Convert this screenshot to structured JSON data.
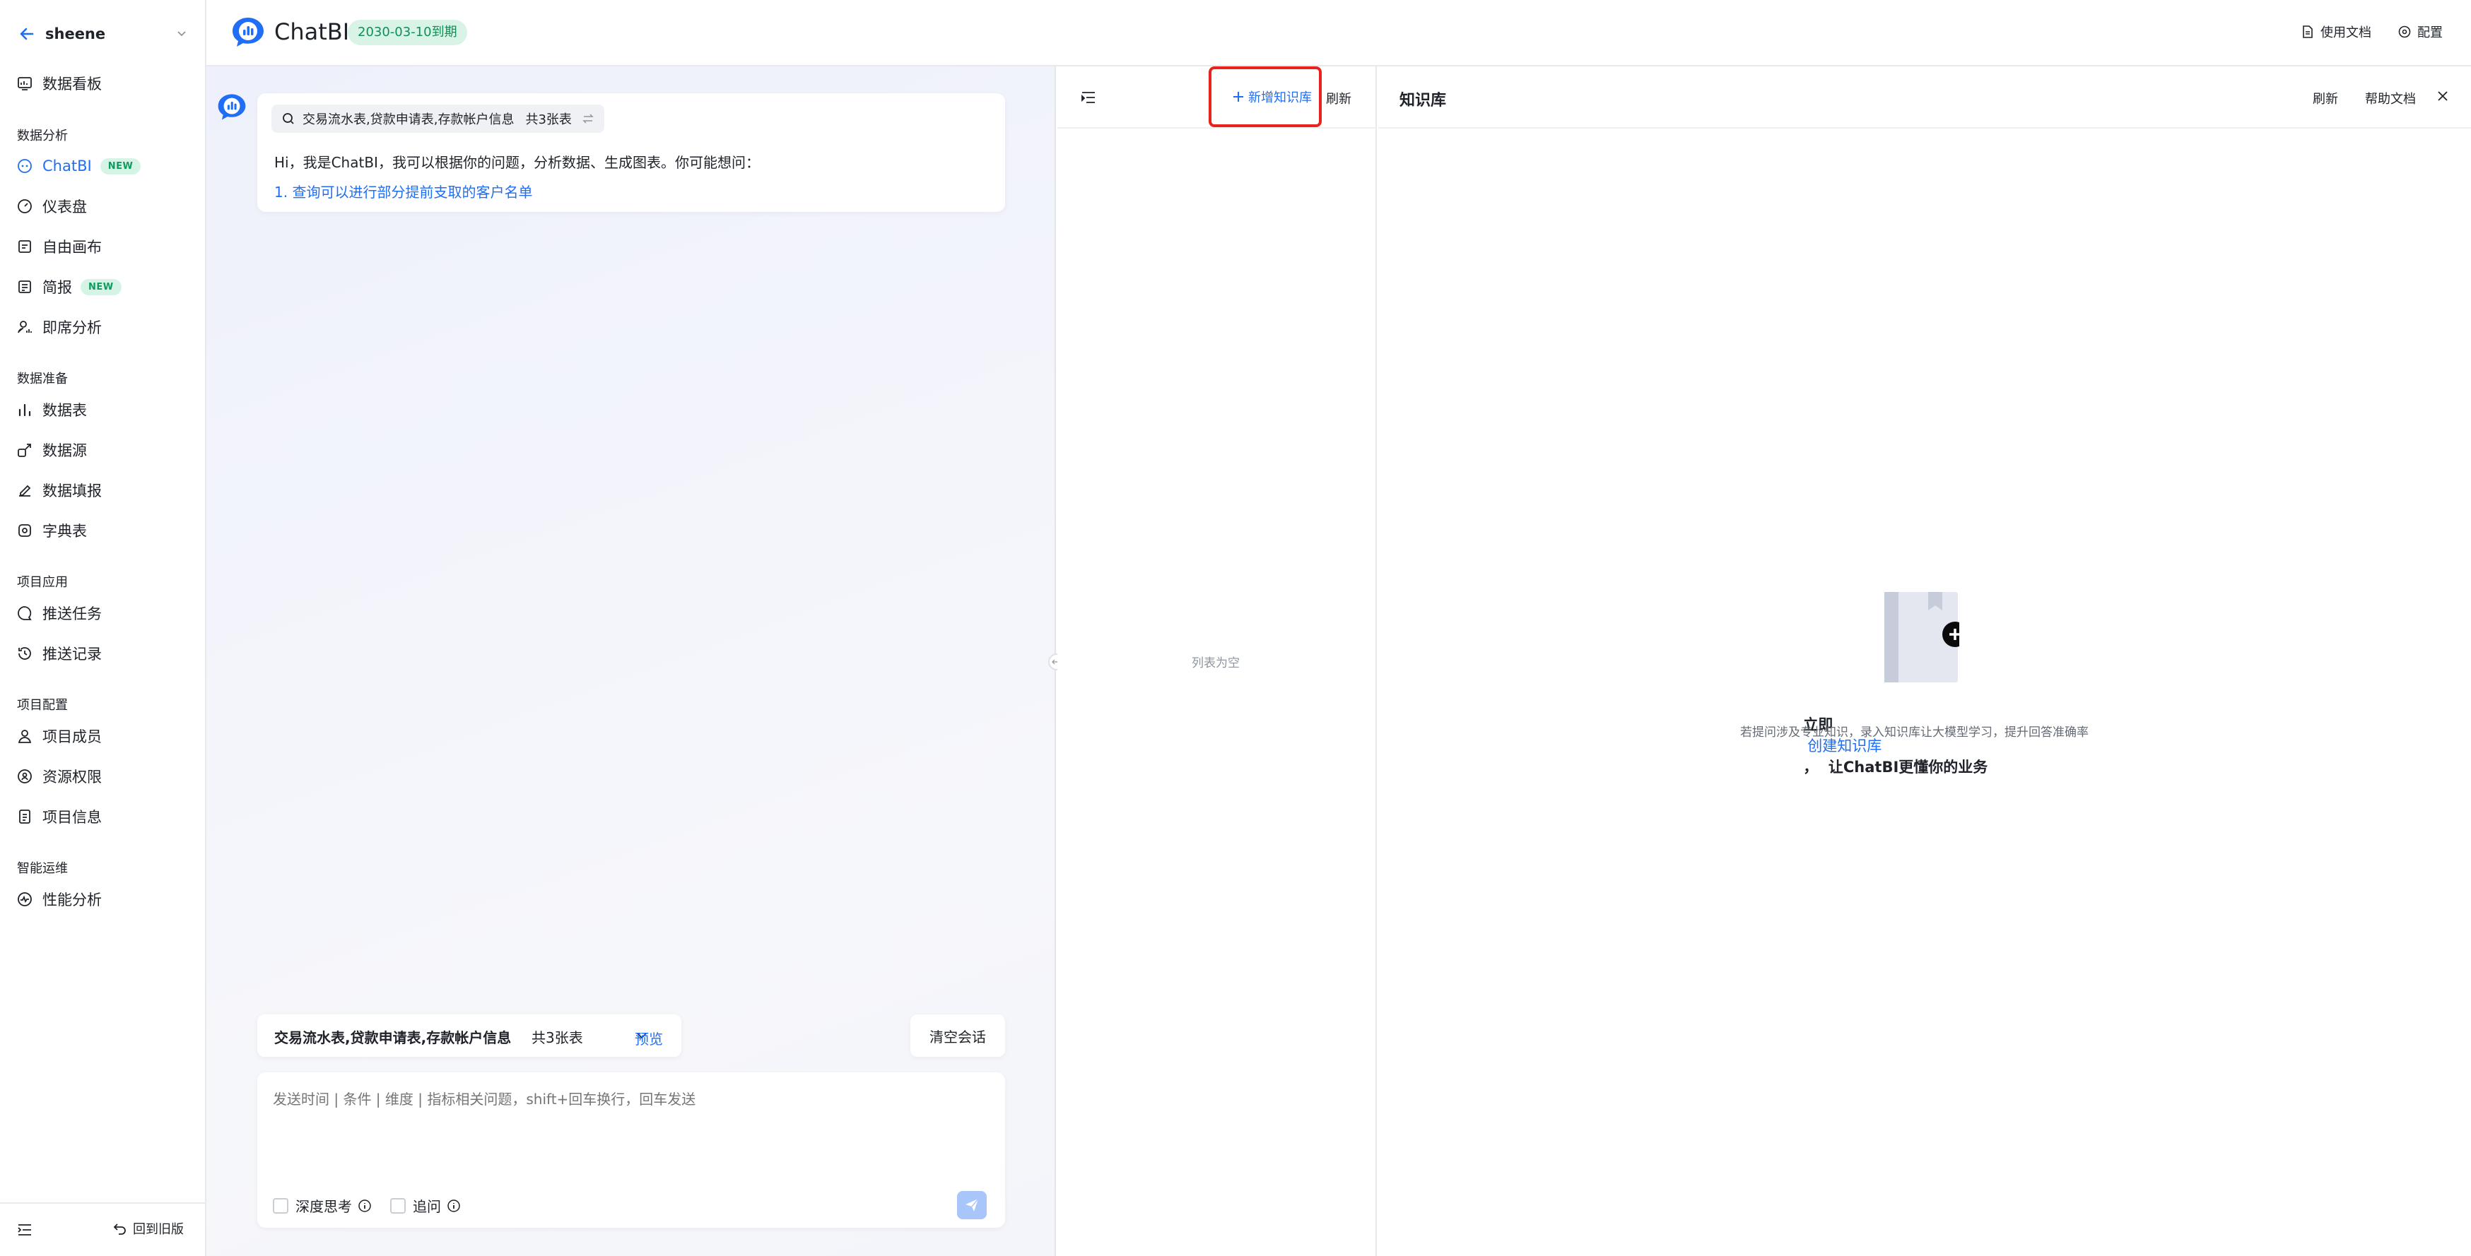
{
  "sidebar": {
    "project": "sheene",
    "top_item": "数据看板",
    "sections": [
      {
        "title": "数据分析",
        "items": [
          {
            "label": "ChatBI",
            "badge": "NEW",
            "active": true
          },
          {
            "label": "仪表盘"
          },
          {
            "label": "自由画布"
          },
          {
            "label": "简报",
            "badge": "NEW"
          },
          {
            "label": "即席分析"
          }
        ]
      },
      {
        "title": "数据准备",
        "items": [
          {
            "label": "数据表"
          },
          {
            "label": "数据源"
          },
          {
            "label": "数据填报"
          },
          {
            "label": "字典表"
          }
        ]
      },
      {
        "title": "项目应用",
        "items": [
          {
            "label": "推送任务"
          },
          {
            "label": "推送记录"
          }
        ]
      },
      {
        "title": "项目配置",
        "items": [
          {
            "label": "项目成员"
          },
          {
            "label": "资源权限"
          },
          {
            "label": "项目信息"
          }
        ]
      },
      {
        "title": "智能运维",
        "items": [
          {
            "label": "性能分析"
          }
        ]
      }
    ],
    "footer": {
      "back_label": "回到旧版"
    }
  },
  "topbar": {
    "title": "ChatBI",
    "expiry": "2030-03-10到期",
    "docs": "使用文档",
    "config": "配置"
  },
  "chat": {
    "tables_chip": "交易流水表,贷款申请表,存款帐户信息",
    "tables_count": "共3张表",
    "greeting": "Hi，我是ChatBI，我可以根据你的问题，分析数据、生成图表。你可能想问：",
    "suggestion": "1. 查询可以进行部分提前支取的客户名单",
    "selector_tables": "交易流水表,贷款申请表,存款帐户信息",
    "selector_count": "共3张表",
    "preview": "预览",
    "clear": "清空会话",
    "input_placeholder": "发送时间 | 条件 | 维度 | 指标相关问题，shift+回车换行，回车发送",
    "deep_think": "深度思考",
    "follow_up": "追问"
  },
  "kb_list": {
    "add_label": "新增知识库",
    "refresh": "刷新",
    "empty": "列表为空"
  },
  "kb_main": {
    "title": "知识库",
    "refresh": "刷新",
    "help": "帮助文档",
    "empty_prefix": "立即",
    "empty_link": "创建知识库",
    "empty_suffix": "，  让ChatBI更懂你的业务",
    "empty_desc": "若提问涉及专业知识，录入知识库让大模型学习，提升回答准确率"
  },
  "colors": {
    "accent": "#1f6ef5",
    "highlight": "#e8231d",
    "badge_bg": "#d6f4e5",
    "badge_text": "#0f9b5f"
  }
}
